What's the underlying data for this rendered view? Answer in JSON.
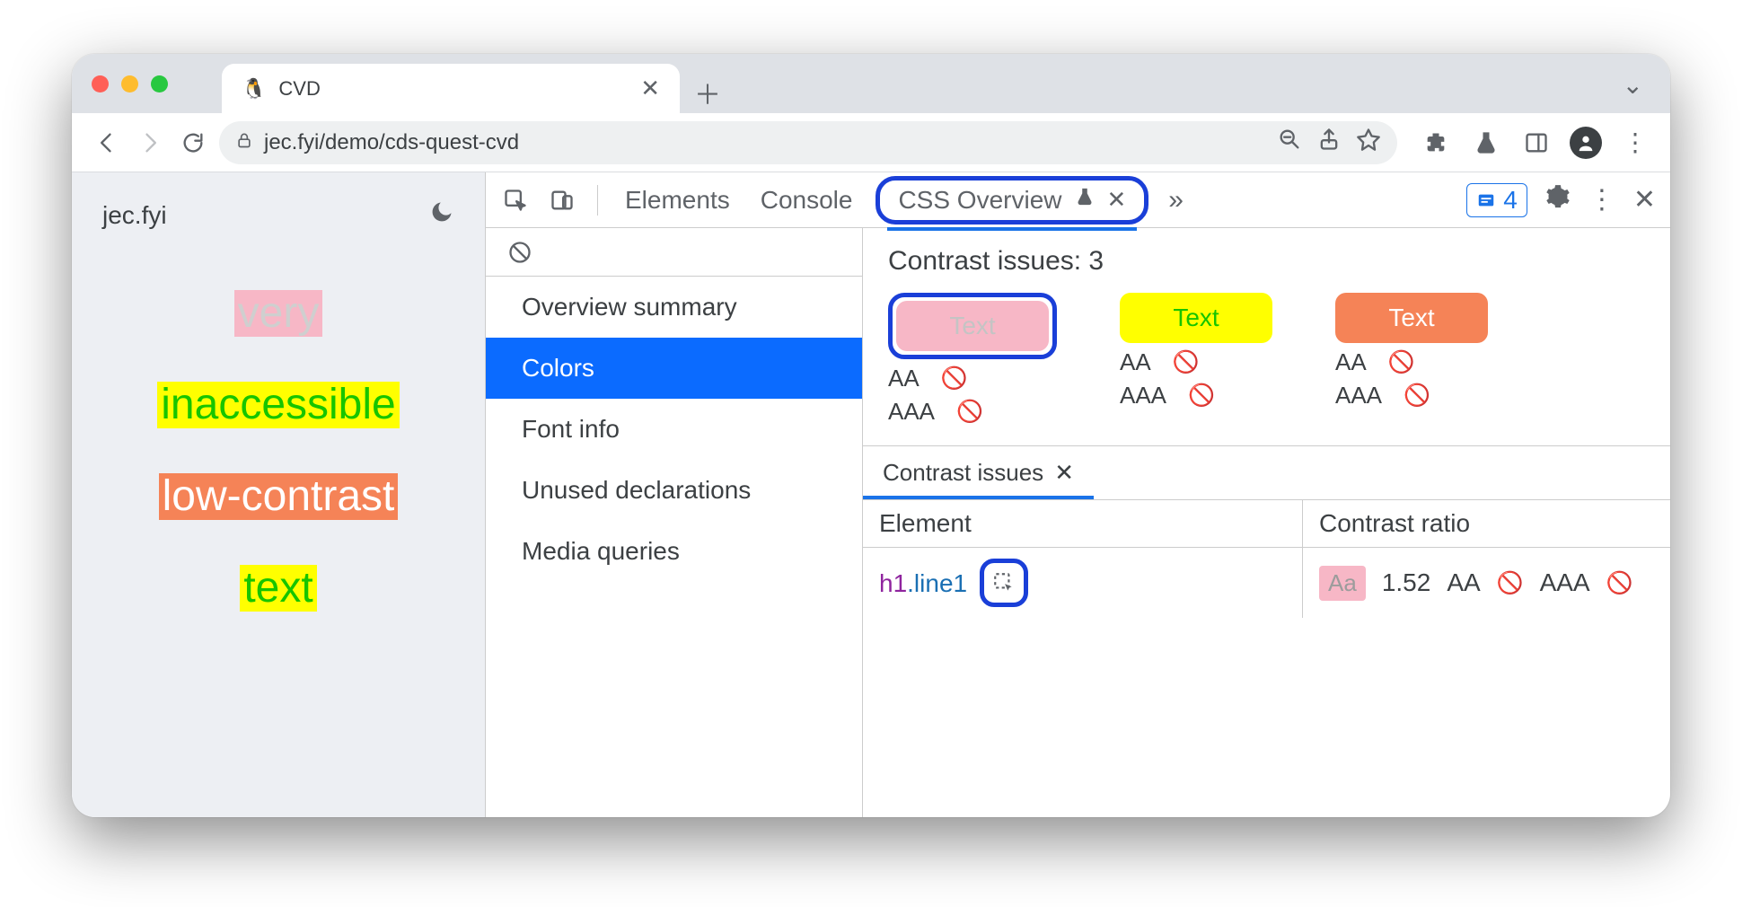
{
  "browser": {
    "tab_title": "CVD",
    "url_display": "jec.fyi/demo/cds-quest-cvd"
  },
  "page": {
    "site_name": "jec.fyi",
    "words": [
      "very",
      "inaccessible",
      "low-contrast",
      "text"
    ]
  },
  "devtools": {
    "tabs": {
      "elements": "Elements",
      "console": "Console",
      "css_overview": "CSS Overview"
    },
    "issues_badge_count": "4",
    "sidebar": {
      "items": [
        "Overview summary",
        "Colors",
        "Font info",
        "Unused declarations",
        "Media queries"
      ],
      "selected_index": 1
    },
    "contrast": {
      "title": "Contrast issues: 3",
      "swatch_label": "Text",
      "aa_label": "AA",
      "aaa_label": "AAA"
    },
    "issues_panel": {
      "tab_label": "Contrast issues",
      "col_element": "Element",
      "col_ratio": "Contrast ratio",
      "row": {
        "selector_tag": "h1",
        "selector_class": ".line1",
        "chip": "Aa",
        "ratio": "1.52",
        "aa": "AA",
        "aaa": "AAA"
      }
    }
  }
}
